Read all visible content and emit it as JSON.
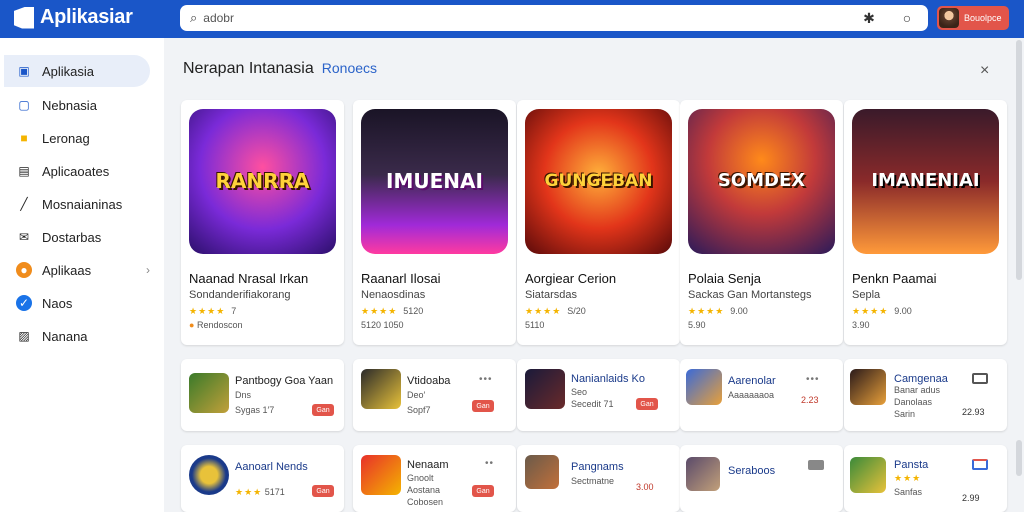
{
  "app": {
    "title": "Aplikasiar"
  },
  "search": {
    "value": "adobr",
    "placeholder": ""
  },
  "profile": {
    "label": "Bouolpce"
  },
  "sidebar": {
    "items": [
      {
        "label": "Aplikasia",
        "icon": "apps-icon",
        "color": "#1a56c8",
        "active": true
      },
      {
        "label": "Nebnasia",
        "icon": "device-icon",
        "color": "#1a56c8"
      },
      {
        "label": "Leronag",
        "icon": "star-icon",
        "color": "#f4b400"
      },
      {
        "label": "Aplicaoates",
        "icon": "grid-icon",
        "color": "#333"
      },
      {
        "label": "Mosnaianinas",
        "icon": "chart-icon",
        "color": "#333"
      },
      {
        "label": "Dostarbas",
        "icon": "mail-icon",
        "color": "#333"
      },
      {
        "label": "Aplikaas",
        "icon": "compass-icon",
        "color": "#f08c1c",
        "chevron": "›"
      },
      {
        "label": "Naos",
        "icon": "shield-icon",
        "color": "#1a73e8"
      },
      {
        "label": "Nanana",
        "icon": "gift-icon",
        "color": "#333"
      }
    ]
  },
  "main": {
    "title": "Nerapan Intanasia",
    "subtitle": "Ronoecs",
    "close": "×"
  },
  "featured": [
    {
      "art": "RANRRA",
      "name": "Naanad Nrasal Irkan",
      "sub": "Sondanderifiakorang",
      "rating": "7",
      "meta": "Rendoscon",
      "colors": [
        "#5a1ec9",
        "#ff4fa0"
      ]
    },
    {
      "art": "IMUENAI",
      "name": "Raanarl Ilosai",
      "sub": "Nenaosdinas",
      "rating": "",
      "meta": "5120",
      "meta2": "5120 1050",
      "colors": [
        "#2a1a3a",
        "#c23ad8"
      ]
    },
    {
      "art": "GUNGEBAN",
      "name": "Aorgiear Cerion",
      "sub": "Siatarsdas",
      "rating": "S/20",
      "meta2": "5110",
      "colors": [
        "#a81818",
        "#ff8a1a"
      ]
    },
    {
      "art": "SOMDEX",
      "name": "Polaia Senja",
      "sub": "Sackas Gan Mortanstegs",
      "rating": "9.00",
      "meta2": "5.90",
      "colors": [
        "#3a2a6a",
        "#ff7a1a"
      ]
    },
    {
      "art": "IMANENIAI",
      "name": "Penkn Paamai",
      "sub": "Sepla",
      "rating": "9.00",
      "meta2": "3.90",
      "colors": [
        "#6a2a3a",
        "#ff9a3a"
      ]
    }
  ],
  "row1": [
    {
      "name": "Pantbogy Goa Yaan",
      "line1": "Dns",
      "line2": "Sygas 1′7",
      "badge": "Gan"
    },
    {
      "name": "Vtidoaba",
      "line1": "Deo′",
      "line2": "Sopf7",
      "badge": "Gan"
    },
    {
      "name": "Nanianlaids Ko",
      "line1": "Seo",
      "line2": "Secedit 71",
      "badge": "Gan"
    },
    {
      "name": "Aarenolar",
      "line1": "Aaaaaaaoa",
      "line2": "",
      "price": "2.23"
    },
    {
      "name": "Camgenaa",
      "line1": "Banar adus",
      "line2": "Danolaas",
      "line3": "Sarin",
      "price": "22.93"
    }
  ],
  "row2": [
    {
      "name": "Aanoarl Nends",
      "rating": "5171",
      "badge": "Gan"
    },
    {
      "name": "Nenaam",
      "line1": "Gnoolt",
      "line2": "Aostana",
      "line3": "Cobosen",
      "badge": "Gan"
    },
    {
      "name": "Pangnams",
      "line1": "Sectmatne",
      "price": "3.00"
    },
    {
      "name": "Seraboos"
    },
    {
      "name": "Pansta",
      "rating": "",
      "line2": "Sanfas",
      "price": "2.99"
    }
  ]
}
